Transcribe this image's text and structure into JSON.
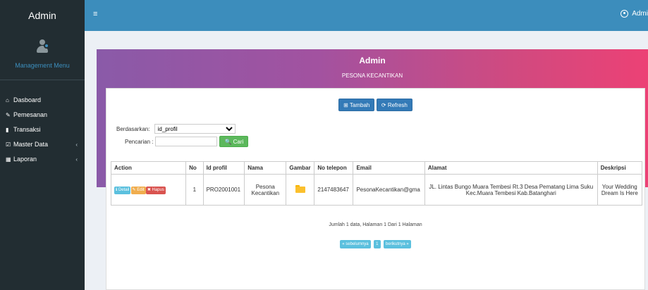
{
  "sidebar": {
    "brand": "Admin",
    "management": "Management Menu",
    "items": [
      {
        "label": "Dasboard",
        "icon": "home-icon",
        "glyph": "⌂",
        "has_children": false
      },
      {
        "label": "Pemesanan",
        "icon": "pencil-icon",
        "glyph": "✎",
        "has_children": false
      },
      {
        "label": "Transaksi",
        "icon": "book-icon",
        "glyph": "▮",
        "has_children": false
      },
      {
        "label": "Master Data",
        "icon": "edit-icon",
        "glyph": "☑",
        "has_children": true
      },
      {
        "label": "Laporan",
        "icon": "calendar-icon",
        "glyph": "▦",
        "has_children": true
      }
    ],
    "chevron": "‹"
  },
  "topbar": {
    "toggle": "≡",
    "user": "Admi"
  },
  "hero": {
    "title": "Admin",
    "subtitle": "PESONA KECANTIKAN"
  },
  "toolbar": {
    "add_label": "⊞ Tambah",
    "refresh_label": "⟳ Refresh"
  },
  "filter": {
    "by_label": "Berdasarkan:",
    "by_value": "id_profil",
    "search_label": "Pencarian :",
    "search_value": "",
    "search_button": "🔍 Cari"
  },
  "table": {
    "headers": [
      "Action",
      "No",
      "Id profil",
      "Nama",
      "Gambar",
      "No telepon",
      "Email",
      "Alamat",
      "Deskripsi"
    ],
    "rows": [
      {
        "detail": "ℹ Detail",
        "edit": "✎ Edit",
        "delete": "✖ Hapus",
        "no": "1",
        "id_profil": "PRO2001001",
        "nama": "Pesona Kecantikan",
        "gambar_icon": "folder-icon",
        "no_telepon": "2147483647",
        "email": "PesonaKecantikan@gma",
        "alamat": "JL. Lintas Bungo Muara Tembesi Rt.3 Desa Pematang Lima Suku Kec.Muara Tembesi Kab.Batanghari",
        "deskripsi": "Your Wedding Dream Is Here"
      }
    ]
  },
  "info": "Jumlah 1 data, Halaman 1 Dari 1 Halaman",
  "pager": {
    "prev": "« sebelumnya",
    "page": "1",
    "next": "berikutnya »"
  },
  "colors": {
    "sidebar_bg": "#222d32",
    "topbar_bg": "#3c8dbc",
    "gradient_start": "#8a5aa8",
    "gradient_end": "#ec4175"
  }
}
